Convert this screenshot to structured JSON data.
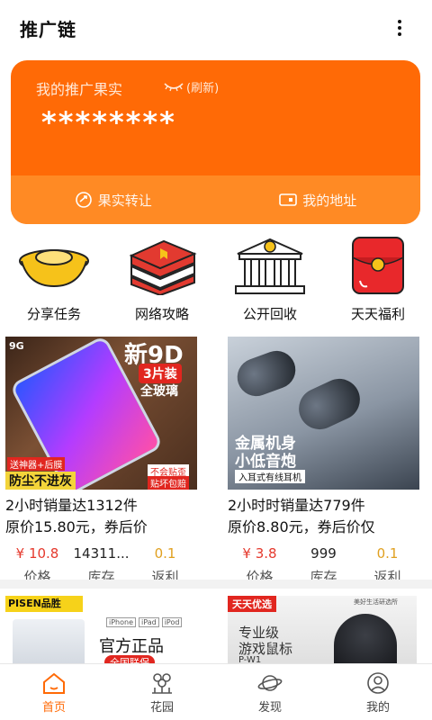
{
  "header": {
    "title": "推广链"
  },
  "earnings_card": {
    "label": "我的推广果实",
    "refresh": "(刷新)",
    "amount": "********",
    "actions": [
      {
        "label": "果实转让",
        "icon": "transfer-icon"
      },
      {
        "label": "我的地址",
        "icon": "address-card-icon"
      }
    ]
  },
  "quick_menu": [
    {
      "label": "分享任务",
      "icon": "gold-ingot-icon"
    },
    {
      "label": "网络攻略",
      "icon": "red-books-icon"
    },
    {
      "label": "公开回收",
      "icon": "bank-building-icon"
    },
    {
      "label": "天天福利",
      "icon": "red-envelope-icon"
    }
  ],
  "products": [
    {
      "name": "2小时销量达1312件",
      "original": "原价15.80元，券后价",
      "price": "¥ 10.8",
      "stock": "14311...",
      "rebate": "0.1",
      "keys": {
        "price": "价格",
        "stock": "库存",
        "rebate": "返利"
      },
      "image_text": {
        "title": "新9D",
        "badge": "3片装",
        "sub": "全玻璃",
        "gift": "送神器+后膜",
        "slogan": "防尘不进灰",
        "tag1": "不会贴歪",
        "tag2": "贴坏包赔",
        "logo": "9G"
      }
    },
    {
      "name": "2小时时销量达779件",
      "original": "原价8.80元，券后价仅",
      "price": "¥ 3.8",
      "stock": "999",
      "rebate": "0.1",
      "keys": {
        "price": "价格",
        "stock": "库存",
        "rebate": "返利"
      },
      "image_text": {
        "line1": "金属机身",
        "line2": "小低音炮",
        "tag": "入耳式有线耳机"
      }
    },
    {
      "image_text": {
        "brand": "PISEN品胜",
        "headline": "官方正品",
        "tag": "全国联保",
        "labels": [
          "iPhone",
          "iPad",
          "iPod"
        ]
      }
    },
    {
      "image_text": {
        "badge": "天天优选",
        "line1": "专业级",
        "line2": "游戏鼠标",
        "model": "P-W1",
        "small": "美好生活研选所"
      }
    }
  ],
  "tabbar": [
    {
      "label": "首页",
      "icon": "home-icon",
      "active": true
    },
    {
      "label": "花园",
      "icon": "garden-icon",
      "active": false
    },
    {
      "label": "发现",
      "icon": "planet-icon",
      "active": false
    },
    {
      "label": "我的",
      "icon": "user-icon",
      "active": false
    }
  ],
  "colors": {
    "accent": "#ff6a06",
    "price_red": "#e5392d",
    "rebate_gold": "#e0a020"
  }
}
